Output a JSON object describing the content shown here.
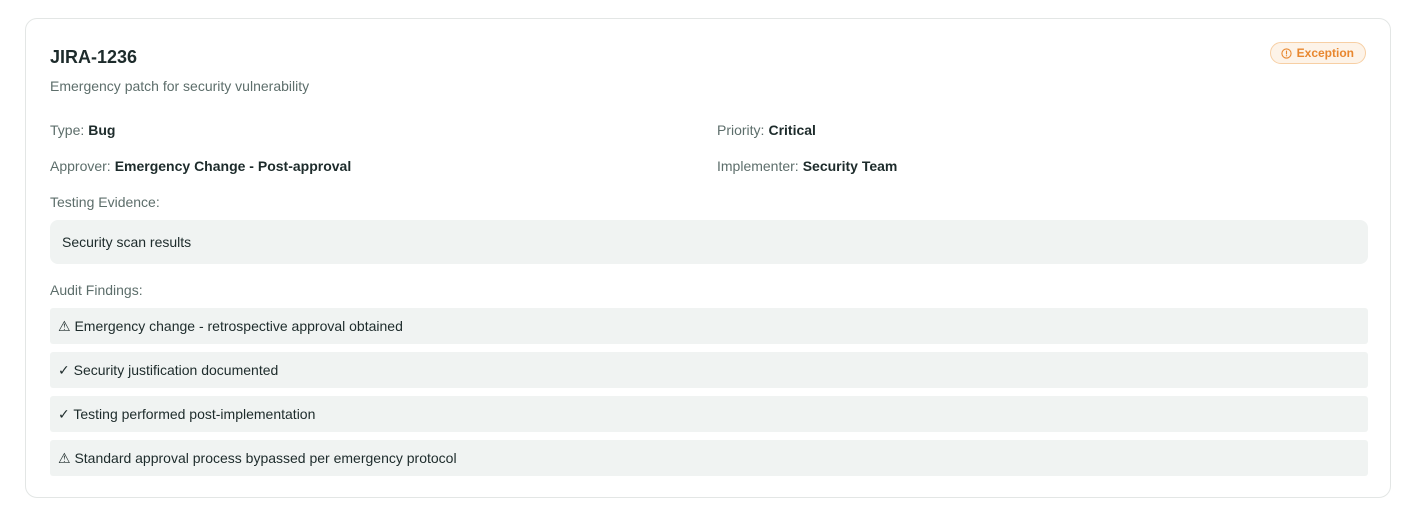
{
  "ticket": {
    "id": "JIRA-1236",
    "description": "Emergency patch for security vulnerability",
    "status_badge": "Exception",
    "status_icon": "info-circle-icon",
    "status_color": "#e8872f"
  },
  "fields": {
    "type": {
      "label": "Type:",
      "value": "Bug"
    },
    "priority": {
      "label": "Priority:",
      "value": "Critical"
    },
    "approver": {
      "label": "Approver:",
      "value": "Emergency Change - Post-approval"
    },
    "implementer": {
      "label": "Implementer:",
      "value": "Security Team"
    }
  },
  "testing_evidence": {
    "label": "Testing Evidence:",
    "value": "Security scan results"
  },
  "audit_findings": {
    "label": "Audit Findings:",
    "items": [
      "⚠ Emergency change - retrospective approval obtained",
      "✓ Security justification documented",
      "✓ Testing performed post-implementation",
      "⚠ Standard approval process bypassed per emergency protocol"
    ]
  }
}
